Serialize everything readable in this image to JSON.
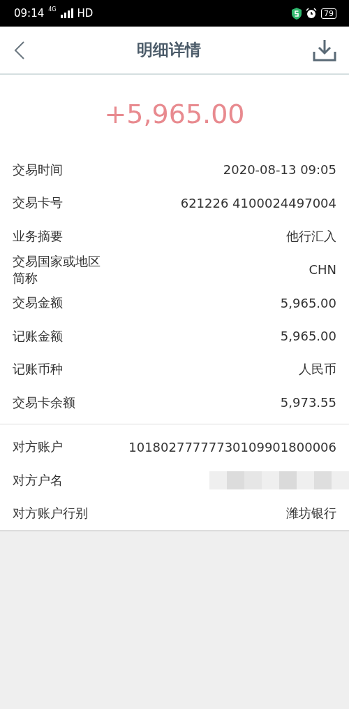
{
  "status_bar": {
    "time": "09:14",
    "network": "4G",
    "hd": "HD",
    "battery": "79"
  },
  "header": {
    "title": "明细详情"
  },
  "amount": "+5,965.00",
  "sections": [
    {
      "rows": [
        {
          "label": "交易时间",
          "value": "2020-08-13 09:05"
        },
        {
          "label": "交易卡号",
          "value": "621226 4100024497004"
        },
        {
          "label": "业务摘要",
          "value": "他行汇入"
        },
        {
          "label": "交易国家或地区简称",
          "value": "CHN"
        },
        {
          "label": "交易金额",
          "value": "5,965.00"
        },
        {
          "label": "记账金额",
          "value": "5,965.00"
        },
        {
          "label": "记账币种",
          "value": "人民币"
        },
        {
          "label": "交易卡余额",
          "value": "5,973.55"
        }
      ]
    },
    {
      "rows": [
        {
          "label": "对方账户",
          "value": "10180277777730109901800006"
        },
        {
          "label": "对方户名",
          "kind": "redacted"
        },
        {
          "label": "对方账户行别",
          "value": "潍坊银行"
        }
      ]
    }
  ]
}
